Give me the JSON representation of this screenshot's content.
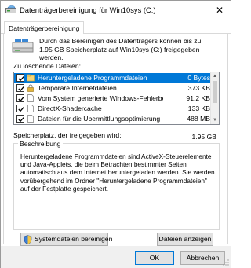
{
  "window": {
    "title": "Datenträgerbereinigung für Win10sys (C:)",
    "close_glyph": "✕"
  },
  "tabs": [
    {
      "label": "Datenträgerbereinigung"
    }
  ],
  "intro": {
    "text": "Durch das Bereinigen des Datenträgers können bis zu 1.95 GB Speicherplatz auf Win10sys (C:) freigegeben werden."
  },
  "files_list": {
    "label": "Zu löschende Dateien:",
    "rows": [
      {
        "name": "Heruntergeladene Programmdateien",
        "size": "0 Bytes",
        "checked": true,
        "selected": true,
        "icon": "folder-icon"
      },
      {
        "name": "Temporäre Internetdateien",
        "size": "373 KB",
        "checked": true,
        "selected": false,
        "icon": "lock-icon"
      },
      {
        "name": "Vom System generierte Windows-Fehlerbe...",
        "size": "91.2 KB",
        "checked": true,
        "selected": false,
        "icon": "document-icon"
      },
      {
        "name": "DirectX-Shadercache",
        "size": "133 KB",
        "checked": true,
        "selected": false,
        "icon": "document-icon"
      },
      {
        "name": "Dateien für die Übermittlungsoptimierung",
        "size": "488 MB",
        "checked": true,
        "selected": false,
        "icon": "document-icon"
      }
    ]
  },
  "space": {
    "label": "Speicherplatz, der freigegeben wird:",
    "value": "1.95 GB"
  },
  "description": {
    "title": "Beschreibung",
    "text": "Heruntergeladene Programmdateien sind ActiveX-Steuerelemente und Java-Applets, die beim Betrachten bestimmter Seiten automatisch aus dem Internet heruntergeladen werden. Sie werden vorübergehend im Ordner \"Heruntergeladene Programmdateien\" auf der Festplatte gespeichert."
  },
  "buttons": {
    "system_cleanup": "Systemdateien bereinigen",
    "show_files": "Dateien anzeigen",
    "ok": "OK",
    "cancel": "Abbrechen"
  },
  "colors": {
    "selection": "#0078d7",
    "button_face": "#e1e1e1",
    "bottom_bar": "#f0f0f0"
  }
}
